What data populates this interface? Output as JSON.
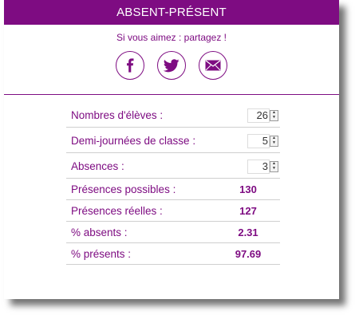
{
  "header": {
    "title": "ABSENT-PRÉSENT"
  },
  "share": {
    "text": "Si vous aimez : partagez !",
    "buttons": [
      {
        "icon": "facebook-icon"
      },
      {
        "icon": "twitter-icon"
      },
      {
        "icon": "mail-icon"
      }
    ]
  },
  "colors": {
    "accent": "#7e0c82",
    "divider": "#cfcfcf"
  },
  "inputs": {
    "eleves": {
      "label": "Nombres d'élèves :",
      "value": "26"
    },
    "demi_journees": {
      "label": "Demi-journées de classe :",
      "value": "5"
    },
    "absences": {
      "label": "Absences :",
      "value": "3"
    }
  },
  "outputs": {
    "presences_possibles": {
      "label": "Présences possibles :",
      "value": "130"
    },
    "presences_reelles": {
      "label": "Présences réelles :",
      "value": "127"
    },
    "pct_absents": {
      "label": "% absents :",
      "value": "2.31"
    },
    "pct_presents": {
      "label": "% présents :",
      "value": "97.69"
    }
  }
}
